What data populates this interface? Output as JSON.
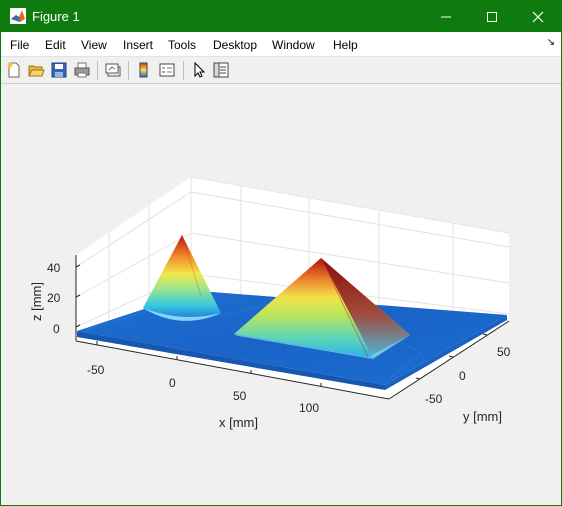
{
  "window": {
    "title": "Figure 1",
    "controls": {
      "minimize": "minimize",
      "maximize": "maximize",
      "close": "close"
    }
  },
  "menubar": {
    "items": [
      "File",
      "Edit",
      "View",
      "Insert",
      "Tools",
      "Desktop",
      "Window",
      "Help"
    ]
  },
  "toolbar": {
    "buttons": [
      "new-figure-icon",
      "open-file-icon",
      "save-icon",
      "print-icon",
      "link-plot-icon",
      "colorbar-icon",
      "legend-icon",
      "pointer-icon",
      "property-inspector-icon"
    ]
  },
  "chart_data": {
    "type": "surface",
    "title": "",
    "xlabel": "x [mm]",
    "ylabel": "y [mm]",
    "zlabel": "z [mm]",
    "xticks": [
      "-50",
      "0",
      "50",
      "100"
    ],
    "yticks": [
      "-50",
      "0",
      "50"
    ],
    "zticks": [
      "0",
      "20",
      "40"
    ],
    "xlim": [
      -70,
      120
    ],
    "ylim": [
      -70,
      70
    ],
    "zlim": [
      -5,
      50
    ],
    "grid": true,
    "colormap": "jet",
    "objects": [
      {
        "shape": "cone",
        "peak_z": 45
      },
      {
        "shape": "pyramid",
        "peak_z": 45
      }
    ]
  }
}
